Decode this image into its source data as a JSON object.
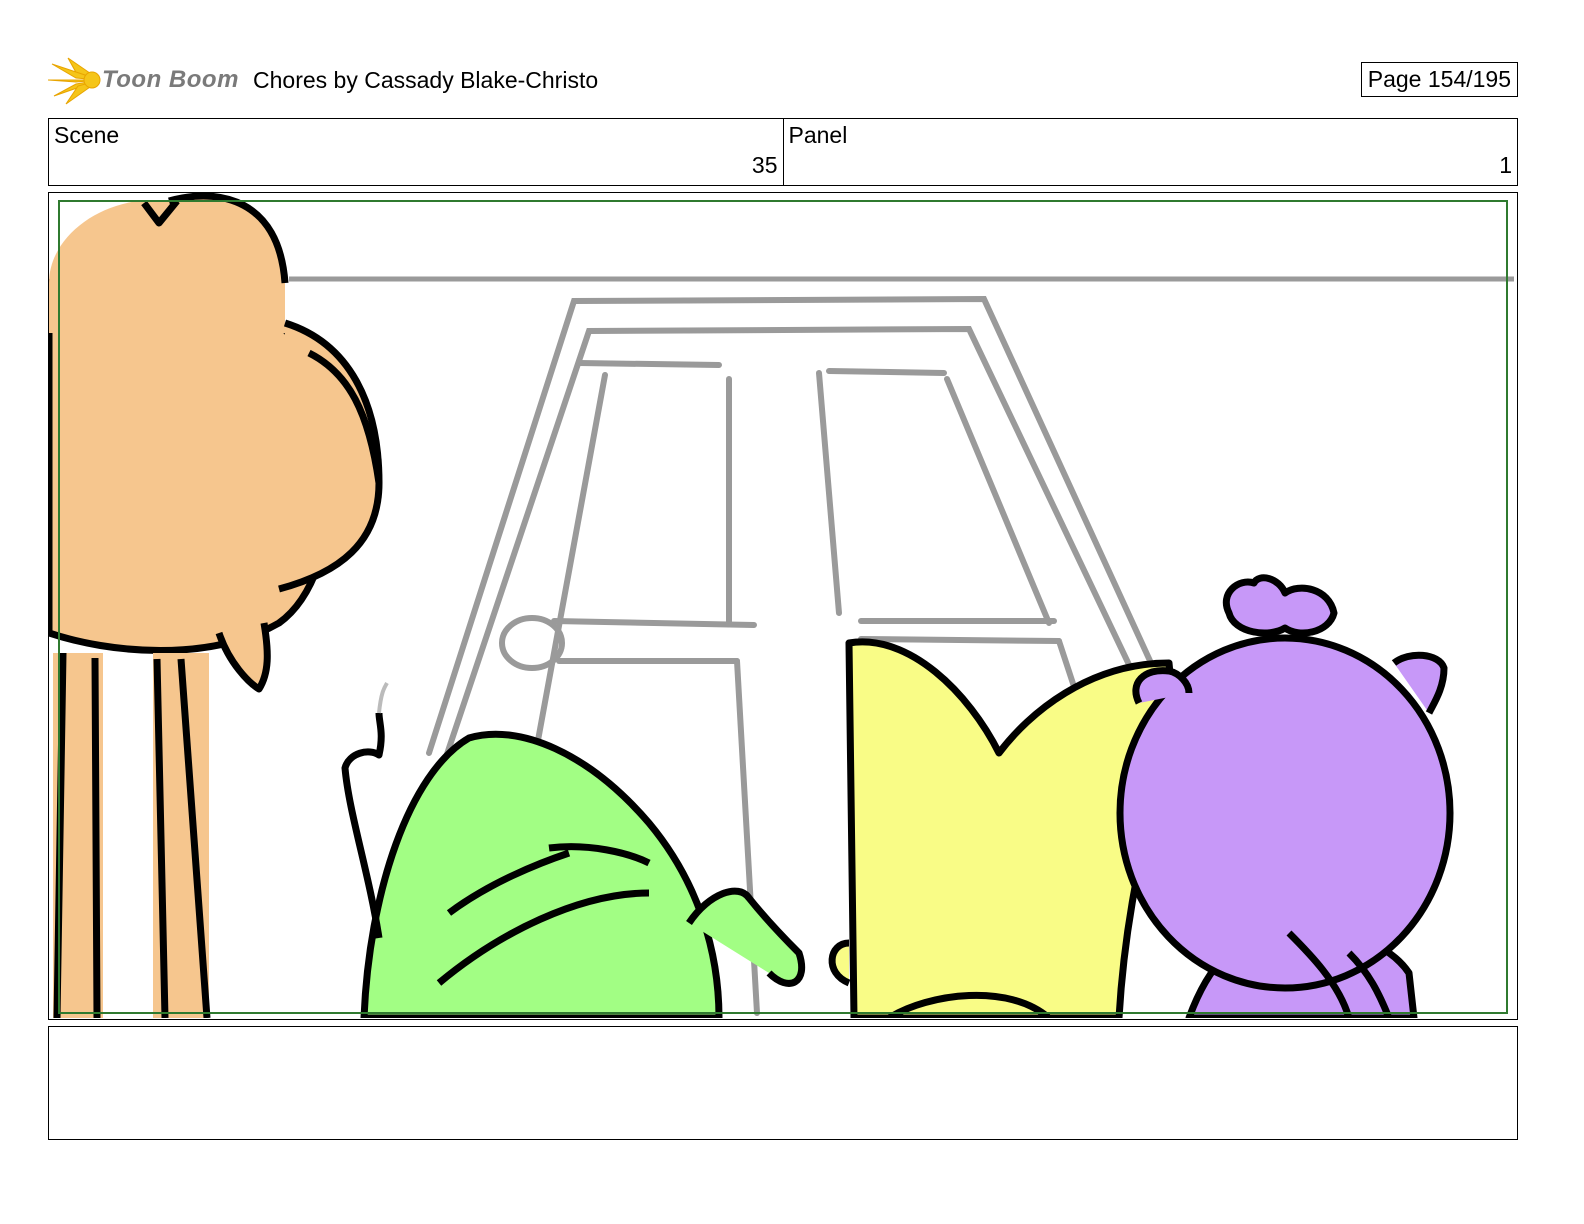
{
  "header": {
    "logo_text": "Toon Boom",
    "title": "Chores  by Cassady Blake-Christo",
    "page": "Page 154/195"
  },
  "info": {
    "scene_label": "Scene",
    "scene_value": "35",
    "panel_label": "Panel",
    "panel_value": "1"
  },
  "notes": {
    "text": ""
  },
  "colors": {
    "orange_character": "#f6c68e",
    "green_character": "#a2fe84",
    "yellow_character": "#f9fc86",
    "purple_character": "#c798f8",
    "door_lines": "#9a9a9a",
    "safe_frame": "#2f7a2f",
    "logo_burst": "#f5c518"
  }
}
